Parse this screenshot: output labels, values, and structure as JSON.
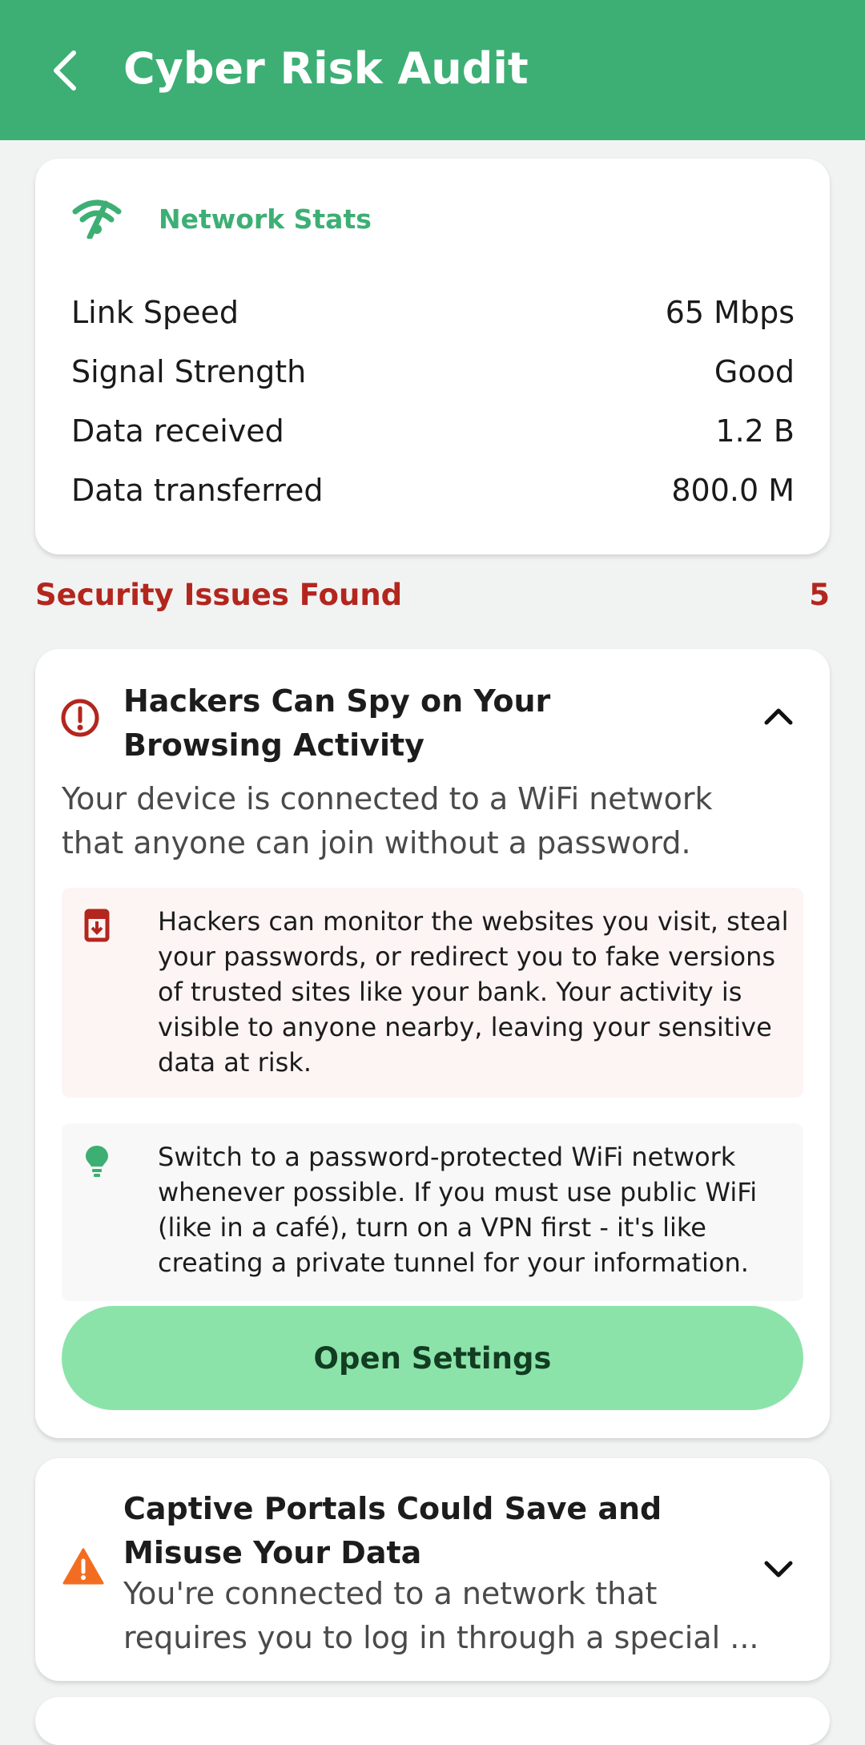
{
  "appbar": {
    "title": "Cyber Risk Audit",
    "back_icon": "chevron-left-icon",
    "background_color": "#3daf74"
  },
  "network_stats": {
    "icon": "wifi-off-icon",
    "title": "Network Stats",
    "rows": [
      {
        "label": "Link Speed",
        "value": "65 Mbps"
      },
      {
        "label": "Signal Strength",
        "value": "Good"
      },
      {
        "label": "Data received",
        "value": "1.2 B"
      },
      {
        "label": "Data transferred",
        "value": "800.0 M"
      }
    ]
  },
  "issues": {
    "header_label": "Security Issues Found",
    "count": "5",
    "accent_color": "#b3261e",
    "items": [
      {
        "icon": "error-circle-icon",
        "title": "Hackers Can Spy on Your Browsing Activity",
        "expanded": true,
        "description": "Your device is connected to a WiFi network that anyone can join without a password.",
        "impact_icon": "download-alert-icon",
        "impact": "Hackers can monitor the websites you visit, steal your passwords, or redirect you to fake versions of trusted sites like your bank. Your activity is visible to anyone nearby, leaving your sensitive data at risk.",
        "tip_icon": "lightbulb-icon",
        "tip": "Switch to a password-protected WiFi network whenever possible. If you must use public WiFi (like in a café), turn on a VPN first - it's like creating a private tunnel for your information.",
        "action_label": "Open Settings"
      },
      {
        "icon": "warning-triangle-icon",
        "title": "Captive Portals Could Save and Misuse Your Data",
        "expanded": false,
        "description": "You're connected to a network that requires you to log in through a special ..."
      }
    ]
  }
}
